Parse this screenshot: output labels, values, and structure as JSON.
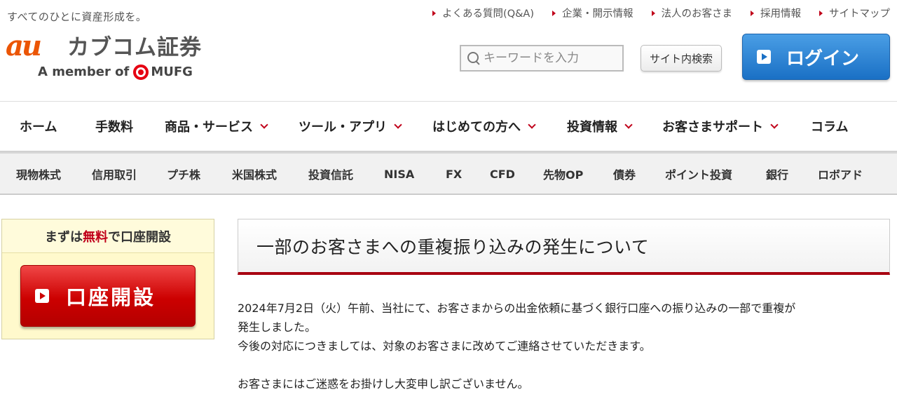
{
  "header": {
    "tagline": "すべてのひとに資産形成を。",
    "logo": {
      "au": "au",
      "name": "カブコム証券",
      "member": "A member of",
      "mufg": "MUFG"
    },
    "util_nav": [
      {
        "label": "よくある質問(Q&A)"
      },
      {
        "label": "企業・開示情報"
      },
      {
        "label": "法人のお客さま"
      },
      {
        "label": "採用情報"
      },
      {
        "label": "サイトマップ"
      }
    ],
    "search": {
      "placeholder": "キーワードを入力",
      "button_label": "サイト内検索"
    },
    "login_label": "ログイン"
  },
  "global_nav": [
    {
      "label": "ホーム",
      "dropdown": false
    },
    {
      "label": "手数料",
      "dropdown": false
    },
    {
      "label": "商品・サービス",
      "dropdown": true
    },
    {
      "label": "ツール・アプリ",
      "dropdown": true
    },
    {
      "label": "はじめての方へ",
      "dropdown": true
    },
    {
      "label": "投資情報",
      "dropdown": true
    },
    {
      "label": "お客さまサポート",
      "dropdown": true
    },
    {
      "label": "コラム",
      "dropdown": false
    }
  ],
  "sub_nav": [
    {
      "label": "現物株式"
    },
    {
      "label": "信用取引"
    },
    {
      "label": "プチ株"
    },
    {
      "label": "米国株式"
    },
    {
      "label": "投資信託"
    },
    {
      "label": "NISA"
    },
    {
      "label": "FX"
    },
    {
      "label": "CFD"
    },
    {
      "label": "先物OP"
    },
    {
      "label": "債券"
    },
    {
      "label": "ポイント投資"
    },
    {
      "label": "銀行"
    },
    {
      "label": "ロボアド"
    }
  ],
  "sidebar": {
    "title_pre": "まずは",
    "title_free": "無料",
    "title_post": "で口座開設",
    "open_account_label": "口座開設"
  },
  "article": {
    "title": "一部のお客さまへの重複振り込みの発生について",
    "paragraph1_line1": "2024年7月2日（火）午前、当社にて、お客さまからの出金依頼に基づく銀行口座への振り込みの一部で重複が",
    "paragraph1_line2": "発生しました。",
    "paragraph2": "今後の対応につきましては、対象のお客さまに改めてご連絡させていただきます。",
    "paragraph3": "お客さまにはご迷惑をお掛けし大変申し訳ございません。"
  },
  "colors": {
    "brand_orange": "#eb5505",
    "accent_red": "#c0001a",
    "login_blue": "#1a70c5",
    "open_account_red": "#cc0000",
    "sidebar_bg": "#fff9cc"
  }
}
